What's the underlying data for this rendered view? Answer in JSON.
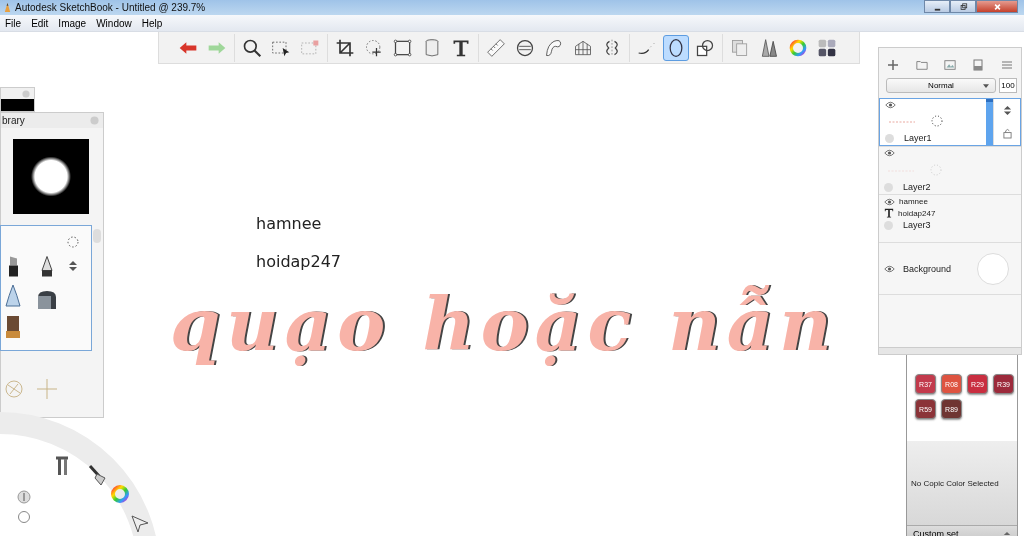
{
  "window": {
    "title": "Autodesk SketchBook - Untitled @ 239.7%"
  },
  "menu": [
    "File",
    "Edit",
    "Image",
    "Window",
    "Help"
  ],
  "toolbar": [
    [
      {
        "kind": "undo",
        "selected": false
      },
      {
        "kind": "redo",
        "selected": false
      }
    ],
    [
      {
        "kind": "zoom",
        "selected": false
      },
      {
        "kind": "select",
        "selected": false
      },
      {
        "kind": "clear-select",
        "selected": false
      }
    ],
    [
      {
        "kind": "crop",
        "selected": false
      },
      {
        "kind": "move",
        "selected": false
      },
      {
        "kind": "distort",
        "selected": false
      },
      {
        "kind": "fill",
        "selected": false
      },
      {
        "kind": "text",
        "selected": false
      }
    ],
    [
      {
        "kind": "ruler",
        "selected": false
      },
      {
        "kind": "ellipse-guide",
        "selected": false
      },
      {
        "kind": "french-curve",
        "selected": false
      },
      {
        "kind": "perspective",
        "selected": false
      },
      {
        "kind": "symmetry",
        "selected": false
      }
    ],
    [
      {
        "kind": "stroke",
        "selected": false
      },
      {
        "kind": "ellipse",
        "selected": true
      },
      {
        "kind": "shapes",
        "selected": false
      }
    ],
    [
      {
        "kind": "copy",
        "selected": false
      },
      {
        "kind": "brushes",
        "selected": false
      },
      {
        "kind": "color",
        "selected": false
      },
      {
        "kind": "palette",
        "selected": false
      }
    ]
  ],
  "brush_library": {
    "title": "brary"
  },
  "canvas": {
    "texts": [
      "hamnee",
      "hoidap247"
    ],
    "lettering": "quạo hoặc nẫn"
  },
  "layers": {
    "blend_mode": "Normal",
    "opacity": "100",
    "items": [
      {
        "kind": "paint",
        "name": "Layer1",
        "selected": true
      },
      {
        "kind": "paint",
        "name": "Layer2",
        "selected": false
      },
      {
        "kind": "text",
        "name": "Layer3",
        "selected": false,
        "texts": [
          "hamnee",
          "hoidap247"
        ]
      },
      {
        "kind": "background",
        "name": "Background",
        "selected": false
      }
    ]
  },
  "copic": {
    "swatches": [
      {
        "label": "R37",
        "color": "#c23a4c"
      },
      {
        "label": "R08",
        "color": "#de5340"
      },
      {
        "label": "R29",
        "color": "#c92e40"
      },
      {
        "label": "R39",
        "color": "#9c2a3b"
      },
      {
        "label": "R59",
        "color": "#8b3338"
      },
      {
        "label": "R89",
        "color": "#6f3532"
      }
    ],
    "status": "No Copic Color Selected",
    "set": "Custom set"
  }
}
